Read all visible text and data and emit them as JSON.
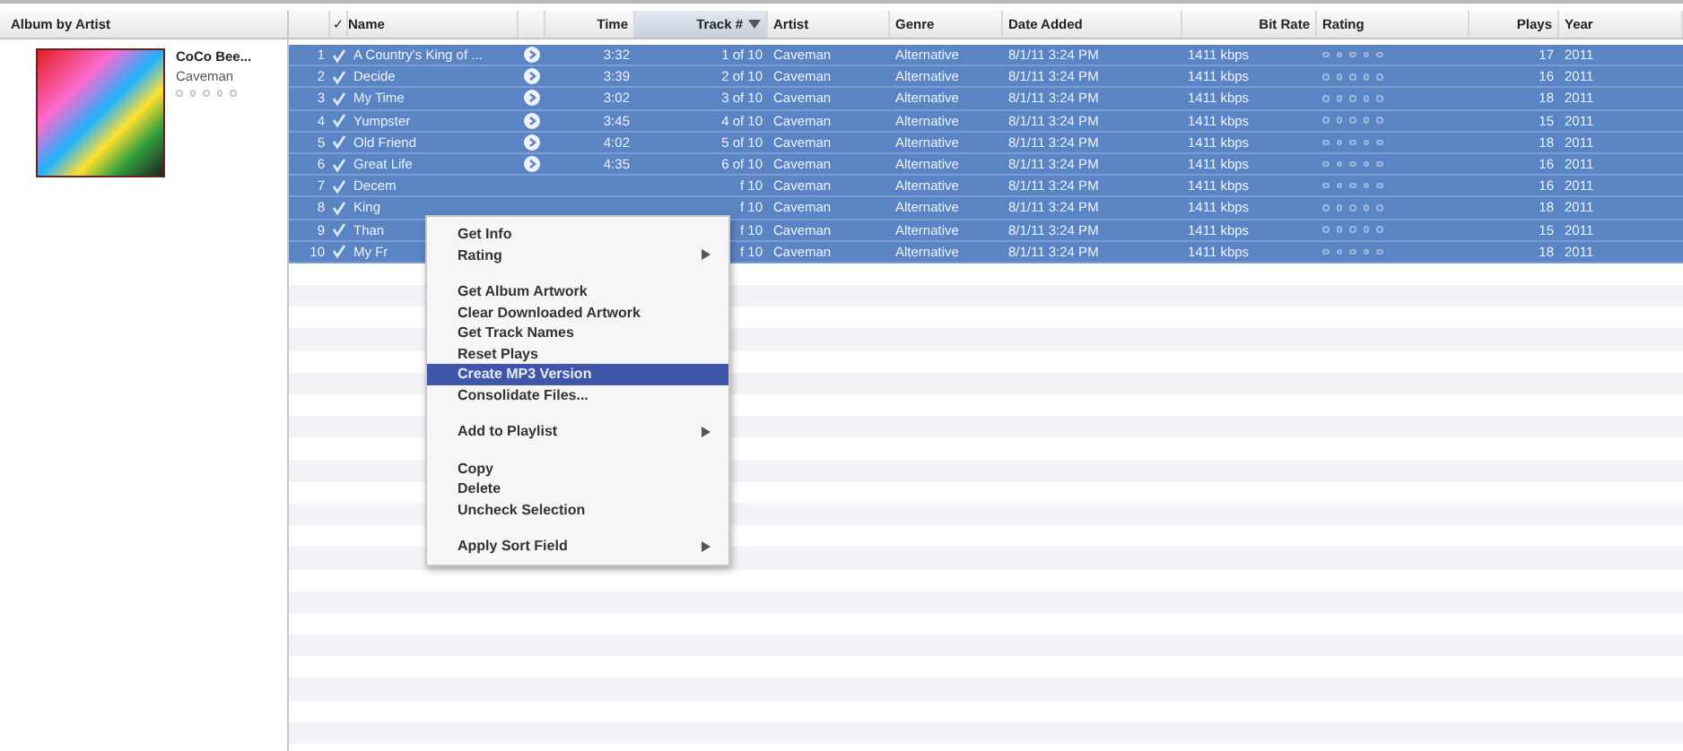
{
  "browser": {
    "header": "Album by Artist",
    "album": "CoCo Bee...",
    "artist": "Caveman",
    "stars": 0
  },
  "table": {
    "columns": [
      {
        "label": "✓",
        "sorted": false
      },
      {
        "label": "Name",
        "sorted": false
      },
      {
        "label": "Time",
        "sorted": false
      },
      {
        "label": "Track #",
        "sorted": true
      },
      {
        "label": "Artist",
        "sorted": false
      },
      {
        "label": "Genre",
        "sorted": false
      },
      {
        "label": "Date Added",
        "sorted": false
      },
      {
        "label": "Bit Rate",
        "sorted": false
      },
      {
        "label": "Rating",
        "sorted": false
      },
      {
        "label": "Plays",
        "sorted": false
      },
      {
        "label": "Year",
        "sorted": false
      }
    ],
    "rows": [
      {
        "num": "1",
        "checked": true,
        "name": "A Country's King of ...",
        "arrow": true,
        "time": "3:32",
        "track": "1 of 10",
        "artist": "Caveman",
        "genre": "Alternative",
        "date": "8/1/11 3:24 PM",
        "bitrate": "1411 kbps",
        "stars": 0,
        "plays": "17",
        "year": "2011",
        "selected": true
      },
      {
        "num": "2",
        "checked": true,
        "name": "Decide",
        "arrow": true,
        "time": "3:39",
        "track": "2 of 10",
        "artist": "Caveman",
        "genre": "Alternative",
        "date": "8/1/11 3:24 PM",
        "bitrate": "1411 kbps",
        "stars": 0,
        "plays": "16",
        "year": "2011",
        "selected": true
      },
      {
        "num": "3",
        "checked": true,
        "name": "My Time",
        "arrow": true,
        "time": "3:02",
        "track": "3 of 10",
        "artist": "Caveman",
        "genre": "Alternative",
        "date": "8/1/11 3:24 PM",
        "bitrate": "1411 kbps",
        "stars": 0,
        "plays": "18",
        "year": "2011",
        "selected": true
      },
      {
        "num": "4",
        "checked": true,
        "name": "Yumpster",
        "arrow": true,
        "time": "3:45",
        "track": "4 of 10",
        "artist": "Caveman",
        "genre": "Alternative",
        "date": "8/1/11 3:24 PM",
        "bitrate": "1411 kbps",
        "stars": 0,
        "plays": "15",
        "year": "2011",
        "selected": true
      },
      {
        "num": "5",
        "checked": true,
        "name": "Old Friend",
        "arrow": true,
        "time": "4:02",
        "track": "5 of 10",
        "artist": "Caveman",
        "genre": "Alternative",
        "date": "8/1/11 3:24 PM",
        "bitrate": "1411 kbps",
        "stars": 0,
        "plays": "18",
        "year": "2011",
        "selected": true
      },
      {
        "num": "6",
        "checked": true,
        "name": "Great Life",
        "arrow": true,
        "time": "4:35",
        "track": "6 of 10",
        "artist": "Caveman",
        "genre": "Alternative",
        "date": "8/1/11 3:24 PM",
        "bitrate": "1411 kbps",
        "stars": 0,
        "plays": "16",
        "year": "2011",
        "selected": true
      },
      {
        "num": "7",
        "checked": true,
        "name": "Decem",
        "arrow": false,
        "track": "f 10",
        "artist": "Caveman",
        "genre": "Alternative",
        "date": "8/1/11 3:24 PM",
        "bitrate": "1411 kbps",
        "stars": 0,
        "plays": "16",
        "year": "2011",
        "selected": true
      },
      {
        "num": "8",
        "checked": true,
        "name": "King",
        "arrow": false,
        "track": "f 10",
        "artist": "Caveman",
        "genre": "Alternative",
        "date": "8/1/11 3:24 PM",
        "bitrate": "1411 kbps",
        "stars": 0,
        "plays": "18",
        "year": "2011",
        "selected": true
      },
      {
        "num": "9",
        "checked": true,
        "name": "Than",
        "arrow": false,
        "track": "f 10",
        "artist": "Caveman",
        "genre": "Alternative",
        "date": "8/1/11 3:24 PM",
        "bitrate": "1411 kbps",
        "stars": 0,
        "plays": "15",
        "year": "2011",
        "selected": true
      },
      {
        "num": "10",
        "checked": true,
        "name": "My Fr",
        "arrow": false,
        "track": "f 10",
        "artist": "Caveman",
        "genre": "Alternative",
        "date": "8/1/11 3:24 PM",
        "bitrate": "1411 kbps",
        "stars": 0,
        "plays": "18",
        "year": "2011",
        "selected": true
      }
    ]
  },
  "context_menu": {
    "items": [
      {
        "kind": "item",
        "label": "Get Info",
        "submenu": false,
        "selected": false
      },
      {
        "kind": "item",
        "label": "Rating",
        "submenu": true,
        "selected": false
      },
      {
        "kind": "separator"
      },
      {
        "kind": "item",
        "label": "Get Album Artwork",
        "submenu": false,
        "selected": false
      },
      {
        "kind": "item",
        "label": "Clear Downloaded Artwork",
        "submenu": false,
        "selected": false
      },
      {
        "kind": "item",
        "label": "Get Track Names",
        "submenu": false,
        "selected": false
      },
      {
        "kind": "item",
        "label": "Reset Plays",
        "submenu": false,
        "selected": false
      },
      {
        "kind": "item",
        "label": "Create MP3 Version",
        "submenu": false,
        "selected": true
      },
      {
        "kind": "item",
        "label": "Consolidate Files...",
        "submenu": false,
        "selected": false
      },
      {
        "kind": "separator"
      },
      {
        "kind": "item",
        "label": "Add to Playlist",
        "submenu": true,
        "selected": false
      },
      {
        "kind": "separator"
      },
      {
        "kind": "item",
        "label": "Copy",
        "submenu": false,
        "selected": false
      },
      {
        "kind": "item",
        "label": "Delete",
        "submenu": false,
        "selected": false
      },
      {
        "kind": "item",
        "label": "Uncheck Selection",
        "submenu": false,
        "selected": false
      },
      {
        "kind": "separator"
      },
      {
        "kind": "item",
        "label": "Apply Sort Field",
        "submenu": true,
        "selected": false
      }
    ]
  }
}
